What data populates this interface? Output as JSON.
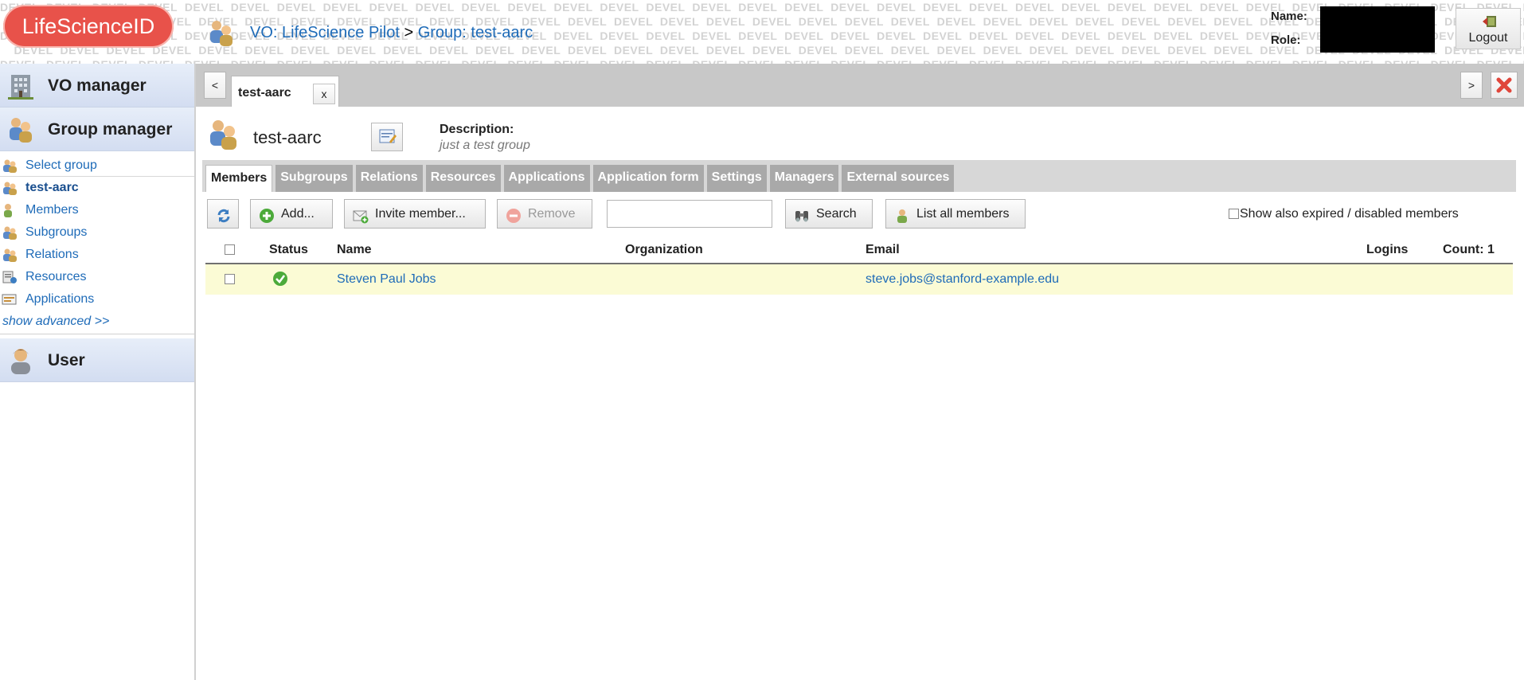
{
  "header": {
    "logo_text": "LifeScienceID",
    "watermark_word": "DEVEL",
    "breadcrumb": {
      "vo_link": "VO: LifeScience Pilot",
      "separator": ">",
      "group_link": "Group: test-aarc"
    },
    "user": {
      "name_label": "Name:",
      "role_label": "Role:",
      "logout_label": "Logout"
    }
  },
  "sidebar": {
    "vo_manager_label": "VO manager",
    "group_manager_label": "Group manager",
    "items": [
      {
        "label": "Select group",
        "icon": "group-icon"
      },
      {
        "label": "test-aarc",
        "icon": "group-icon"
      },
      {
        "label": "Members",
        "icon": "member-icon"
      },
      {
        "label": "Subgroups",
        "icon": "group-icon"
      },
      {
        "label": "Relations",
        "icon": "group-icon"
      },
      {
        "label": "Resources",
        "icon": "resource-icon"
      },
      {
        "label": "Applications",
        "icon": "applications-icon"
      }
    ],
    "show_advanced": "show advanced >>",
    "user_label": "User"
  },
  "tabbar": {
    "prev": "<",
    "next": ">",
    "open_tab_label": "test-aarc",
    "open_tab_close": "x"
  },
  "group": {
    "title": "test-aarc",
    "description_label": "Description:",
    "description_value": "just a test group"
  },
  "subtabs": [
    "Members",
    "Subgroups",
    "Relations",
    "Resources",
    "Applications",
    "Application form",
    "Settings",
    "Managers",
    "External sources"
  ],
  "toolbar": {
    "add_label": "Add...",
    "invite_label": "Invite member...",
    "remove_label": "Remove",
    "search_value": "",
    "search_label": "Search",
    "list_all_label": "List all members",
    "show_expired_label": "Show also expired / disabled members"
  },
  "table": {
    "headers": {
      "status": "Status",
      "name": "Name",
      "organization": "Organization",
      "email": "Email",
      "logins": "Logins",
      "count": "Count: 1"
    },
    "rows": [
      {
        "status": "valid",
        "name": "Steven Paul Jobs",
        "organization": "",
        "email": "steve.jobs@stanford-example.edu",
        "logins": ""
      }
    ]
  },
  "colors": {
    "link": "#1e6bb8",
    "logo": "#e8524a",
    "row_highlight": "#fbfbd5",
    "subtab_inactive": "#a9a9a9"
  }
}
